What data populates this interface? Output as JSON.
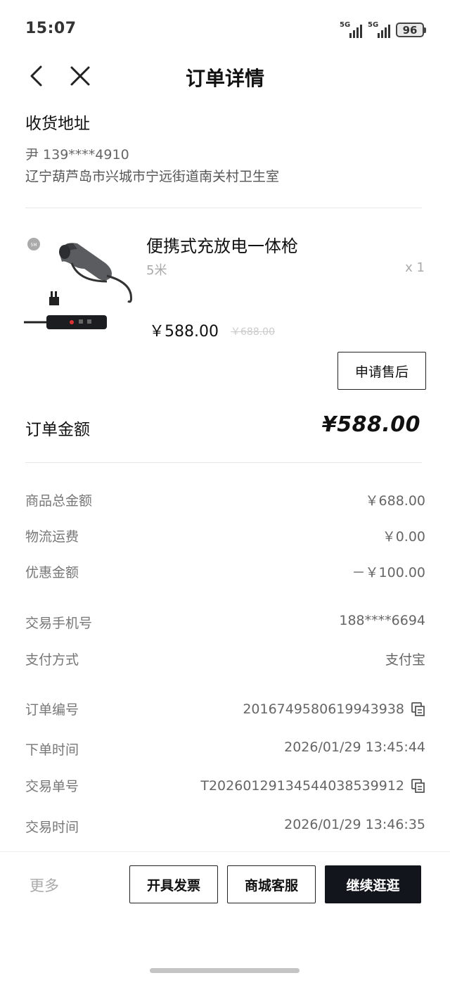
{
  "status_bar": {
    "time": "15:07",
    "signal_1_label": "5G",
    "signal_2_label": "5G",
    "battery": "96"
  },
  "nav": {
    "title": "订单详情",
    "back_icon": "chevron-left-icon",
    "close_icon": "close-icon"
  },
  "address": {
    "section_title": "收货地址",
    "name_phone": "尹  139****4910",
    "address_line": "辽宁葫芦岛市兴城市宁远街道南关村卫生室"
  },
  "product": {
    "name": "便携式充放电一体枪",
    "spec": "5米",
    "quantity": "x 1",
    "price": "￥588.00",
    "original_price": "￥688.00",
    "after_sale_button": "申请售后",
    "image_icon": "charging-gun-icon"
  },
  "order_total": {
    "label": "订单金额",
    "value": "¥588.00"
  },
  "details": [
    {
      "label": "商品总金额",
      "value": "￥688.00"
    },
    {
      "label": "物流运费",
      "value": "￥0.00"
    },
    {
      "label": "优惠金额",
      "value": "－￥100.00"
    },
    {
      "label": "交易手机号",
      "value": "188****6694"
    },
    {
      "label": "支付方式",
      "value": "支付宝"
    },
    {
      "label": "订单编号",
      "value": "2016749580619943938",
      "copyable": true
    },
    {
      "label": "下单时间",
      "value": "2026/01/29 13:45:44"
    },
    {
      "label": "交易单号",
      "value": "T2026012913454403853991​2",
      "copyable": true
    },
    {
      "label": "交易时间",
      "value": "2026/01/29 13:46:35"
    }
  ],
  "bottom_bar": {
    "more": "更多",
    "invoice_button": "开具发票",
    "service_button": "商城客服",
    "continue_button": "继续逛逛"
  },
  "colors": {
    "primary_dark": "#12151c",
    "text_main": "#111111",
    "text_secondary": "#777777"
  }
}
